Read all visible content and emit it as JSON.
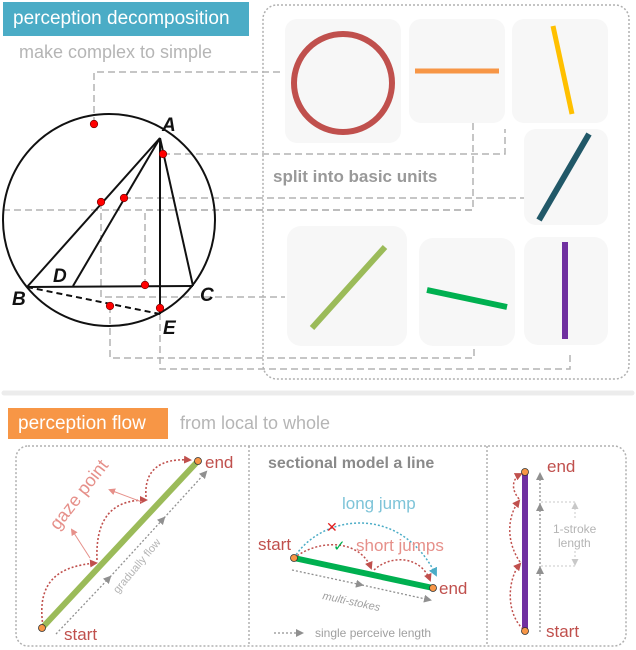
{
  "section1": {
    "tag": "perception decomposition",
    "tag_color": "#4bacc6",
    "subtitle": "make complex to simple",
    "center_label": "split into basic units",
    "geometry_labels": [
      "A",
      "B",
      "C",
      "D",
      "E"
    ],
    "units": [
      {
        "name": "circle",
        "color": "#c0504d"
      },
      {
        "name": "horizontal-line",
        "color": "#f79646"
      },
      {
        "name": "steep-line",
        "color": "#ffc000"
      },
      {
        "name": "diagonal-line",
        "color": "#215868"
      },
      {
        "name": "long-diagonal-line",
        "color": "#9bbb59"
      },
      {
        "name": "slanted-line",
        "color": "#00b050"
      },
      {
        "name": "vertical-line",
        "color": "#7030a0"
      }
    ]
  },
  "section2": {
    "tag": "perception flow",
    "tag_color": "#f79646",
    "subtitle": "from local to whole",
    "panel1": {
      "end_label": "end",
      "start_label": "start",
      "gaze_label": "gaze point",
      "flow_label": "gradually flow"
    },
    "panel2": {
      "title": "sectional model a line",
      "long_jump_label": "long jump",
      "short_jumps_label": "short jumps",
      "start_label": "start",
      "end_label": "end",
      "multi_label": "multi-stokes",
      "legend_label": "single perceive length",
      "wrong_mark": "✕",
      "right_mark": "✓"
    },
    "panel3": {
      "end_label": "end",
      "start_label": "start",
      "stroke_label_1": "1-stroke",
      "stroke_label_2": "length"
    }
  },
  "colors": {
    "label_red": "#c0504d",
    "gaze_pink": "#e6908a",
    "long_jump_blue": "#4bacc6",
    "gray_text": "#a0a0a0",
    "dashed_gray": "#b4b4b4",
    "card_bg": "#f7f7f7",
    "node_orange": "#f79646",
    "red_dot": "#ff0000"
  }
}
